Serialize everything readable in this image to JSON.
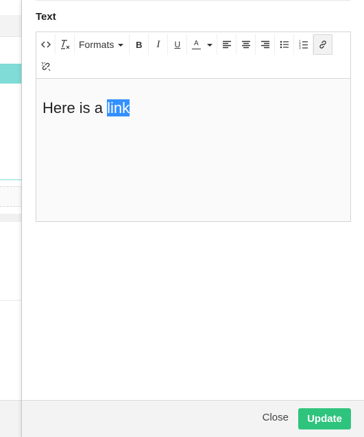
{
  "field": {
    "label": "Text"
  },
  "toolbar": {
    "formats_label": "Formats",
    "bold_label": "B",
    "italic_label": "I",
    "underline_label": "U",
    "text_color_label": "A",
    "icons": [
      "source-code-icon",
      "clear-formatting-icon",
      "bold-icon",
      "italic-icon",
      "underline-icon",
      "text-color-icon",
      "align-left-icon",
      "align-center-icon",
      "align-right-icon",
      "bullet-list-icon",
      "numbered-list-icon",
      "link-icon",
      "unlink-icon"
    ],
    "active": "link-icon"
  },
  "editor": {
    "text_before": "Here is a ",
    "selected_text": "link",
    "selection_color": "#3390ff"
  },
  "footer": {
    "close_label": "Close",
    "update_label": "Update",
    "update_color": "#2fc47e"
  }
}
